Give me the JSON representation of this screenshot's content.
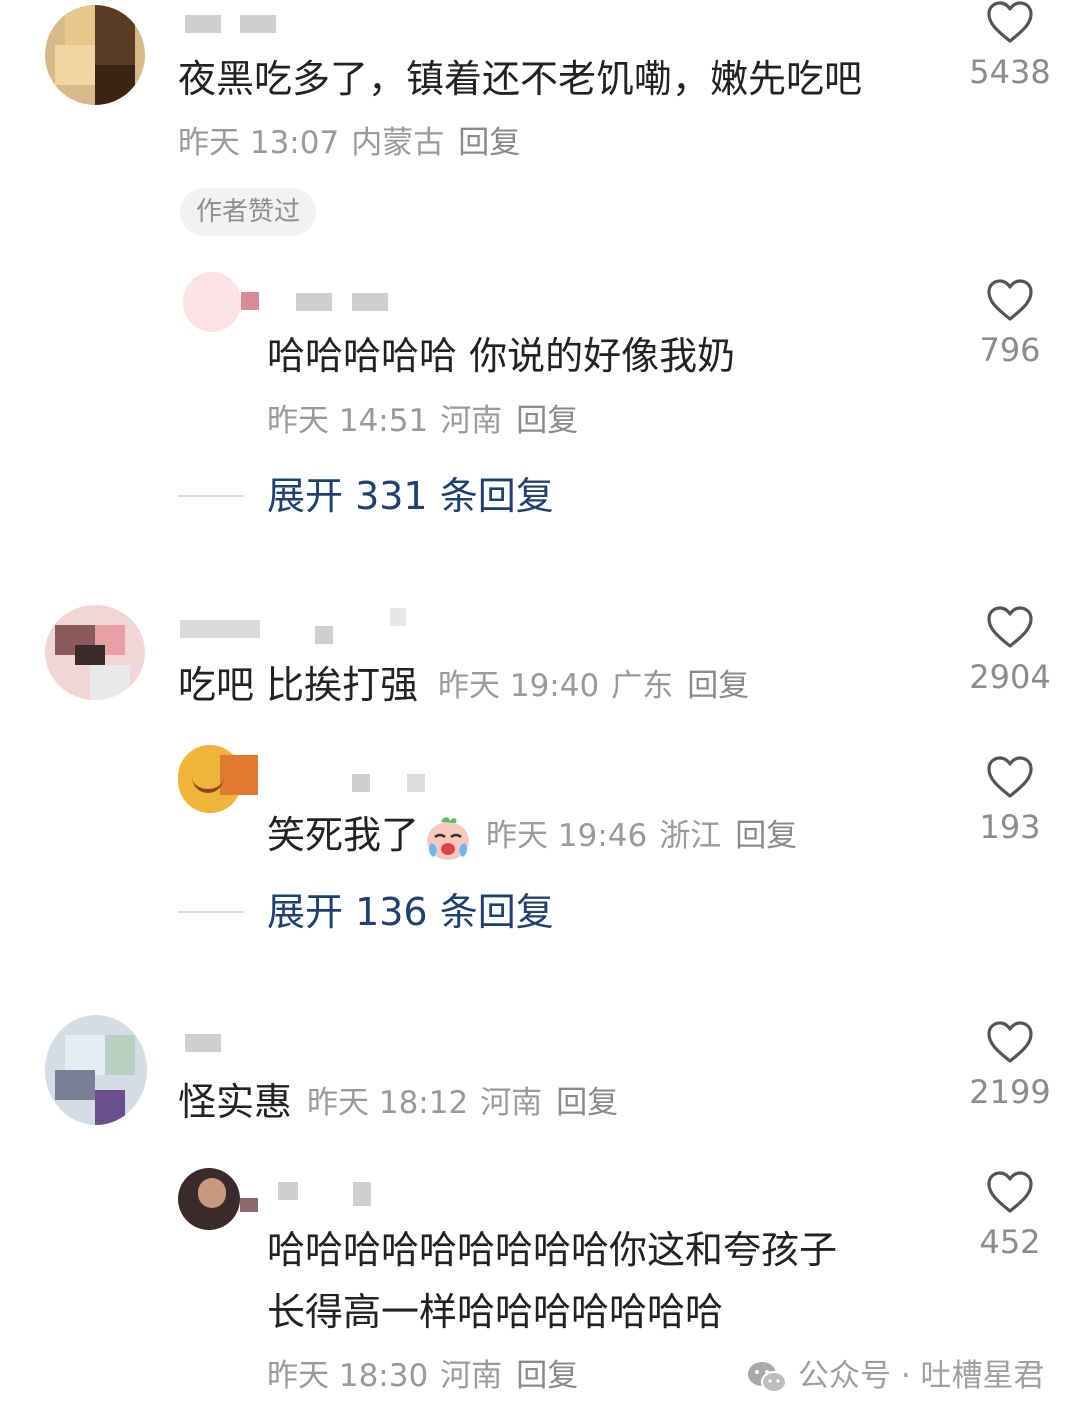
{
  "like_icon": "heart-outline-icon",
  "colors": {
    "link": "#20406e",
    "meta": "#9a9a9a",
    "text": "#222222"
  },
  "comments": [
    {
      "text": "夜黑吃多了，镇着还不老饥嘞，嫩先吃吧",
      "time": "昨天 13:07",
      "location": "内蒙古",
      "reply": "回复",
      "likes": "5438",
      "badge": "作者赞过",
      "replies": [
        {
          "text": "哈哈哈哈哈 你说的好像我奶",
          "time": "昨天 14:51",
          "location": "河南",
          "reply": "回复",
          "likes": "796"
        }
      ],
      "expand": "展开 331 条回复"
    },
    {
      "text": "吃吧 比挨打强",
      "time": "昨天 19:40",
      "location": "广东",
      "reply": "回复",
      "likes": "2904",
      "replies": [
        {
          "text": "笑死我了",
          "emoji": "crying-laughing-emoji",
          "time": "昨天 19:46",
          "location": "浙江",
          "reply": "回复",
          "likes": "193"
        }
      ],
      "expand": "展开 136 条回复"
    },
    {
      "text": "怪实惠",
      "time": "昨天 18:12",
      "location": "河南",
      "reply": "回复",
      "likes": "2199",
      "replies": [
        {
          "text_line1": "哈哈哈哈哈哈哈哈哈你这和夸孩子",
          "text_line2": "长得高一样哈哈哈哈哈哈哈",
          "time": "昨天 18:30",
          "location": "河南",
          "reply": "回复",
          "likes": "452"
        }
      ]
    }
  ],
  "watermark": {
    "icon": "wechat-icon",
    "text": "公众号 · 吐槽星君"
  }
}
